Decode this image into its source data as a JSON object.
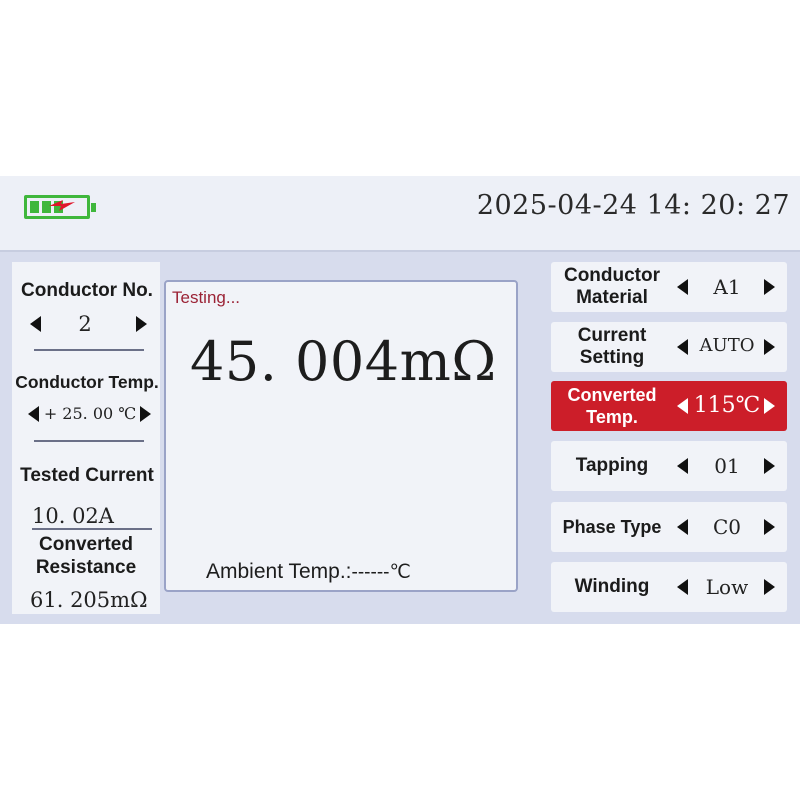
{
  "status": {
    "datetime": "2025-04-24 14: 20: 27",
    "battery_icon": "battery-charging-icon",
    "battery_color": "#3fb73c"
  },
  "left": {
    "conductor_no_label": "Conductor No.",
    "conductor_no_value": "2",
    "conductor_temp_label": "Conductor Temp.",
    "conductor_temp_value": "+ 25. 00 ℃",
    "tested_current_label": "Tested Current",
    "tested_current_value": "10. 02A",
    "converted_resistance_label_1": "Converted",
    "converted_resistance_label_2": "Resistance",
    "converted_resistance_value": "61. 205mΩ"
  },
  "center": {
    "status_text": "Testing...",
    "reading": "45. 004mΩ",
    "ambient_label": "Ambient Temp.:",
    "ambient_value": "------℃"
  },
  "settings": [
    {
      "label_1": "Conductor",
      "label_2": "Material",
      "value": "A1",
      "active": false
    },
    {
      "label_1": "Current",
      "label_2": "Setting",
      "value": "AUTO",
      "active": false
    },
    {
      "label_1": "Converted",
      "label_2": "Temp.",
      "value": "115℃",
      "active": true
    },
    {
      "label_1": "Tapping",
      "label_2": "",
      "value": "01",
      "active": false
    },
    {
      "label_1": "Phase Type",
      "label_2": "",
      "value": "C0",
      "active": false
    },
    {
      "label_1": "Winding",
      "label_2": "",
      "value": "Low",
      "active": false
    }
  ],
  "colors": {
    "accent_red": "#cc1e29",
    "testing_text": "#9b2235",
    "panel_bg": "#f1f3f8",
    "screen_bg": "#d7dced"
  }
}
